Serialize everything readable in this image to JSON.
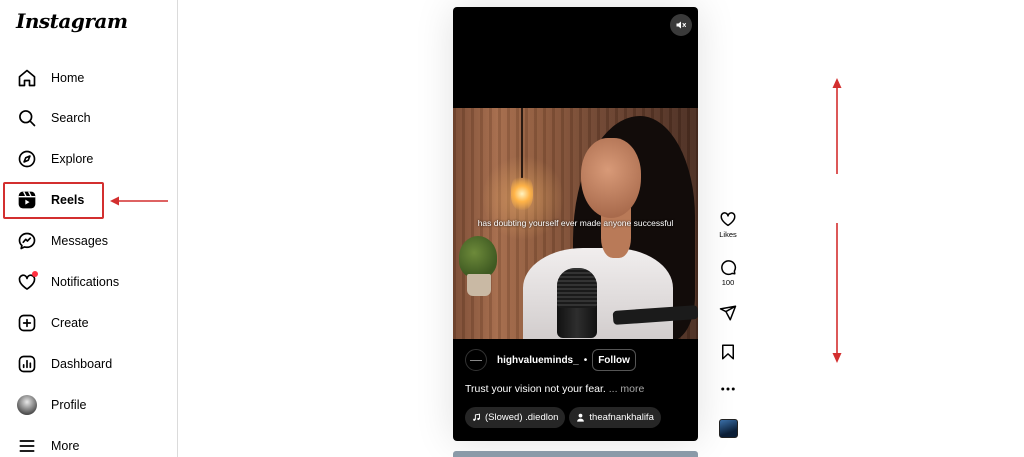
{
  "sidebar": {
    "logo": "Instagram",
    "items": [
      {
        "label": "Home",
        "icon": "home-icon"
      },
      {
        "label": "Search",
        "icon": "search-icon"
      },
      {
        "label": "Explore",
        "icon": "compass-icon"
      },
      {
        "label": "Reels",
        "icon": "reels-icon",
        "active": true
      },
      {
        "label": "Messages",
        "icon": "messenger-icon"
      },
      {
        "label": "Notifications",
        "icon": "heart-icon",
        "badge": true
      },
      {
        "label": "Create",
        "icon": "plus-square-icon"
      },
      {
        "label": "Dashboard",
        "icon": "dashboard-icon"
      },
      {
        "label": "Profile",
        "icon": "avatar"
      },
      {
        "label": "More",
        "icon": "menu-icon"
      }
    ]
  },
  "reel": {
    "overlay_caption": "has doubting yourself ever made anyone successful",
    "author": "highvalueminds_",
    "separator": "•",
    "follow_label": "Follow",
    "caption_text": "Trust your vision not your fear.",
    "caption_more": "... more",
    "audio_chip": "(Slowed)  .diedlon",
    "tag_chip": "theafnankhalifa"
  },
  "actions": {
    "likes_label": "Likes",
    "comments_count": "100"
  },
  "colors": {
    "annotation_red": "#d32f2f",
    "notification_red": "#ff3040"
  }
}
